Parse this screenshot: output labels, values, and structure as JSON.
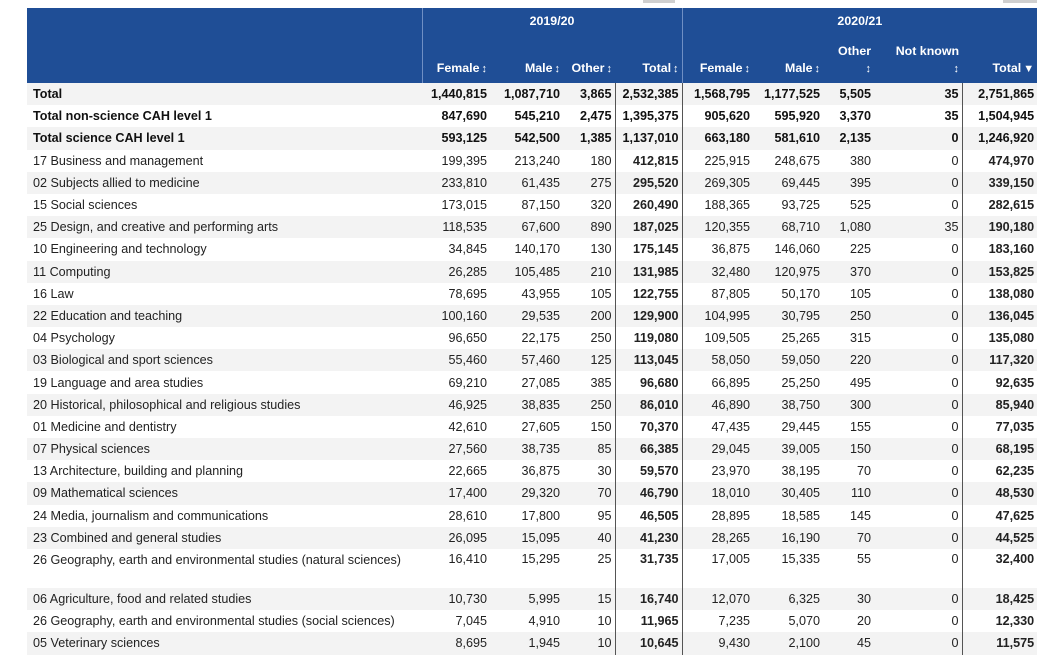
{
  "years": [
    "2019/20",
    "2020/21"
  ],
  "columns": [
    {
      "label": "Female",
      "icon": "sort-arrows-icon"
    },
    {
      "label": "Male",
      "icon": "sort-arrows-icon"
    },
    {
      "label": "Other",
      "icon": "sort-arrows-icon"
    },
    {
      "label": "Total",
      "icon": "sort-arrows-icon"
    },
    {
      "label": "Female",
      "icon": "sort-arrows-icon"
    },
    {
      "label": "Male",
      "icon": "sort-arrows-icon"
    },
    {
      "label": "Other",
      "icon": "sort-arrows-icon"
    },
    {
      "label": "Not known",
      "icon": "sort-arrows-icon"
    },
    {
      "label": "Total",
      "icon": "sort-desc-icon"
    }
  ],
  "rows": [
    {
      "label": "Total",
      "bold": true,
      "values": [
        "1,440,815",
        "1,087,710",
        "3,865",
        "2,532,385",
        "1,568,795",
        "1,177,525",
        "5,505",
        "35",
        "2,751,865"
      ]
    },
    {
      "label": "Total non-science CAH level 1",
      "bold": true,
      "values": [
        "847,690",
        "545,210",
        "2,475",
        "1,395,375",
        "905,620",
        "595,920",
        "3,370",
        "35",
        "1,504,945"
      ]
    },
    {
      "label": "Total science CAH level 1",
      "bold": true,
      "values": [
        "593,125",
        "542,500",
        "1,385",
        "1,137,010",
        "663,180",
        "581,610",
        "2,135",
        "0",
        "1,246,920"
      ]
    },
    {
      "label": "17 Business and management",
      "values": [
        "199,395",
        "213,240",
        "180",
        "412,815",
        "225,915",
        "248,675",
        "380",
        "0",
        "474,970"
      ]
    },
    {
      "label": "02 Subjects allied to medicine",
      "values": [
        "233,810",
        "61,435",
        "275",
        "295,520",
        "269,305",
        "69,445",
        "395",
        "0",
        "339,150"
      ]
    },
    {
      "label": "15 Social sciences",
      "values": [
        "173,015",
        "87,150",
        "320",
        "260,490",
        "188,365",
        "93,725",
        "525",
        "0",
        "282,615"
      ]
    },
    {
      "label": "25 Design, and creative and performing arts",
      "values": [
        "118,535",
        "67,600",
        "890",
        "187,025",
        "120,355",
        "68,710",
        "1,080",
        "35",
        "190,180"
      ]
    },
    {
      "label": "10 Engineering and technology",
      "values": [
        "34,845",
        "140,170",
        "130",
        "175,145",
        "36,875",
        "146,060",
        "225",
        "0",
        "183,160"
      ]
    },
    {
      "label": "11 Computing",
      "values": [
        "26,285",
        "105,485",
        "210",
        "131,985",
        "32,480",
        "120,975",
        "370",
        "0",
        "153,825"
      ]
    },
    {
      "label": "16 Law",
      "values": [
        "78,695",
        "43,955",
        "105",
        "122,755",
        "87,805",
        "50,170",
        "105",
        "0",
        "138,080"
      ]
    },
    {
      "label": "22 Education and teaching",
      "values": [
        "100,160",
        "29,535",
        "200",
        "129,900",
        "104,995",
        "30,795",
        "250",
        "0",
        "136,045"
      ]
    },
    {
      "label": "04 Psychology",
      "values": [
        "96,650",
        "22,175",
        "250",
        "119,080",
        "109,505",
        "25,265",
        "315",
        "0",
        "135,080"
      ]
    },
    {
      "label": "03 Biological and sport sciences",
      "values": [
        "55,460",
        "57,460",
        "125",
        "113,045",
        "58,050",
        "59,050",
        "220",
        "0",
        "117,320"
      ]
    },
    {
      "label": "19 Language and area studies",
      "values": [
        "69,210",
        "27,085",
        "385",
        "96,680",
        "66,895",
        "25,250",
        "495",
        "0",
        "92,635"
      ]
    },
    {
      "label": "20 Historical, philosophical and religious studies",
      "values": [
        "46,925",
        "38,835",
        "250",
        "86,010",
        "46,890",
        "38,750",
        "300",
        "0",
        "85,940"
      ]
    },
    {
      "label": "01 Medicine and dentistry",
      "values": [
        "42,610",
        "27,605",
        "150",
        "70,370",
        "47,435",
        "29,445",
        "155",
        "0",
        "77,035"
      ]
    },
    {
      "label": "07 Physical sciences",
      "values": [
        "27,560",
        "38,735",
        "85",
        "66,385",
        "29,045",
        "39,005",
        "150",
        "0",
        "68,195"
      ]
    },
    {
      "label": "13 Architecture, building and planning",
      "values": [
        "22,665",
        "36,875",
        "30",
        "59,570",
        "23,970",
        "38,195",
        "70",
        "0",
        "62,235"
      ]
    },
    {
      "label": "09 Mathematical sciences",
      "values": [
        "17,400",
        "29,320",
        "70",
        "46,790",
        "18,010",
        "30,405",
        "110",
        "0",
        "48,530"
      ]
    },
    {
      "label": "24 Media, journalism and communications",
      "values": [
        "28,610",
        "17,800",
        "95",
        "46,505",
        "28,895",
        "18,585",
        "145",
        "0",
        "47,625"
      ]
    },
    {
      "label": "23 Combined and general studies",
      "values": [
        "26,095",
        "15,095",
        "40",
        "41,230",
        "28,265",
        "16,190",
        "70",
        "0",
        "44,525"
      ]
    },
    {
      "label": "26 Geography, earth and environmental studies (natural sciences)",
      "tall": true,
      "values": [
        "16,410",
        "15,295",
        "25",
        "31,735",
        "17,005",
        "15,335",
        "55",
        "0",
        "32,400"
      ]
    },
    {
      "label": "06 Agriculture, food and related studies",
      "values": [
        "10,730",
        "5,995",
        "15",
        "16,740",
        "12,070",
        "6,325",
        "30",
        "0",
        "18,425"
      ]
    },
    {
      "label": "26 Geography, earth and environmental studies (social sciences)",
      "values": [
        "7,045",
        "4,910",
        "10",
        "11,965",
        "7,235",
        "5,070",
        "20",
        "0",
        "12,330"
      ]
    },
    {
      "label": "05 Veterinary sciences",
      "values": [
        "8,695",
        "1,945",
        "10",
        "10,645",
        "9,430",
        "2,100",
        "45",
        "0",
        "11,575"
      ]
    }
  ],
  "glyphs": {
    "sort": "↕",
    "desc": "▼"
  },
  "colors": {
    "header_bg": "#1f4e96",
    "stripe": "#f3f3f3"
  }
}
